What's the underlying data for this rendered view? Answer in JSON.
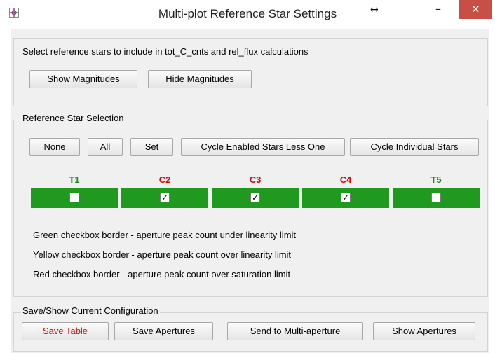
{
  "window": {
    "title": "Multi-plot Reference Star Settings",
    "title_arrow": "↔",
    "minimize": "–",
    "close": "✕"
  },
  "intro": {
    "instruction": "Select reference stars to include in tot_C_cnts and rel_flux calculations",
    "show_magnitudes": "Show Magnitudes",
    "hide_magnitudes": "Hide Magnitudes"
  },
  "selection": {
    "legend": "Reference Star Selection",
    "buttons": {
      "none": "None",
      "all": "All",
      "set": "Set",
      "cycle_enabled": "Cycle Enabled Stars Less One",
      "cycle_individual": "Cycle Individual Stars"
    },
    "stars": [
      {
        "label": "T1",
        "checked": false,
        "label_color": "#1a8a1a"
      },
      {
        "label": "C2",
        "checked": true,
        "label_color": "#e00000"
      },
      {
        "label": "C3",
        "checked": true,
        "label_color": "#e00000"
      },
      {
        "label": "C4",
        "checked": true,
        "label_color": "#e00000"
      },
      {
        "label": "T5",
        "checked": false,
        "label_color": "#1a8a1a"
      }
    ],
    "bar_color": "#1f9a1f",
    "notes": [
      "Green checkbox border - aperture peak count under linearity limit",
      "Yellow checkbox border - aperture peak count over linearity limit",
      "Red checkbox border - aperture peak count over saturation limit"
    ]
  },
  "config": {
    "legend": "Save/Show Current Configuration",
    "save_table": "Save Table",
    "save_apertures": "Save Apertures",
    "send_multi": "Send to Multi-aperture",
    "show_apertures": "Show Apertures"
  }
}
